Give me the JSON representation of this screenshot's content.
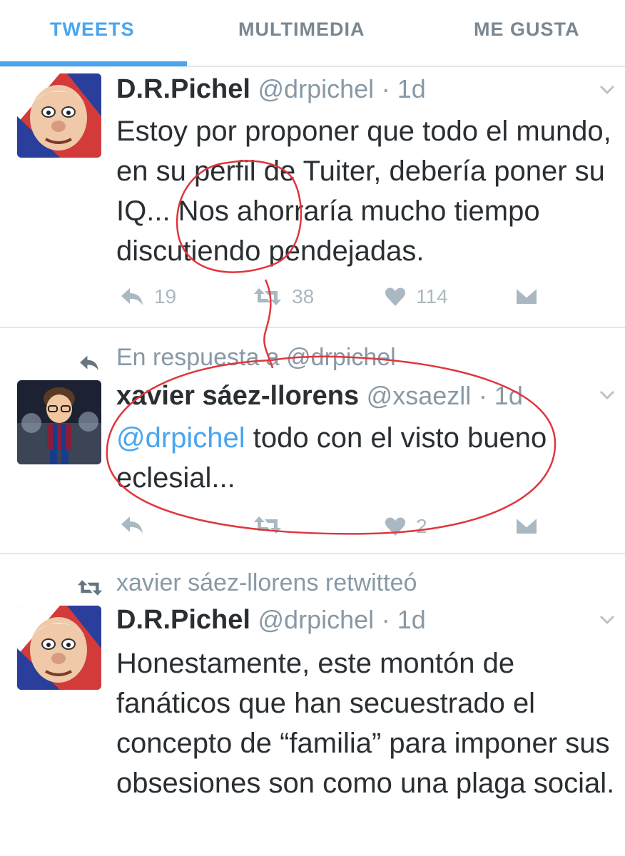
{
  "tabs": [
    {
      "label": "TWEETS",
      "active": true
    },
    {
      "label": "MULTIMEDIA",
      "active": false
    },
    {
      "label": "ME GUSTA",
      "active": false
    }
  ],
  "colors": {
    "accent": "#4aa5ee",
    "annotation": "#e0363c",
    "muted": "#8899a6",
    "icon": "#aab8c2"
  },
  "tweets": [
    {
      "name": "D.R.Pichel",
      "handle": "@drpichel",
      "time": "· 1d",
      "text": "Estoy por proponer que todo el mundo, en su perfil de Tuiter, debería poner su IQ... Nos ahorraría mucho tiempo discutiendo pendejadas.",
      "replies": "19",
      "retweets": "38",
      "likes": "114",
      "avatar_icon": "caricature-avatar"
    },
    {
      "reply_context": "En respuesta a @drpichel",
      "name": "xavier sáez-llorens",
      "handle": "@xsaezll",
      "time": "· 1d",
      "mention": "@drpichel",
      "text": " todo con el visto bueno eclesial...",
      "replies": "",
      "retweets": "",
      "likes": "2",
      "avatar_icon": "cartoon-player-avatar"
    },
    {
      "retweet_context": "xavier sáez-llorens retwitteó",
      "name": "D.R.Pichel",
      "handle": "@drpichel",
      "time": "· 1d",
      "text": "Honestamente, este montón de fanáticos que han secuestrado el concepto de “familia” para imponer sus obsesiones son como una plaga social.",
      "avatar_icon": "caricature-avatar"
    }
  ]
}
